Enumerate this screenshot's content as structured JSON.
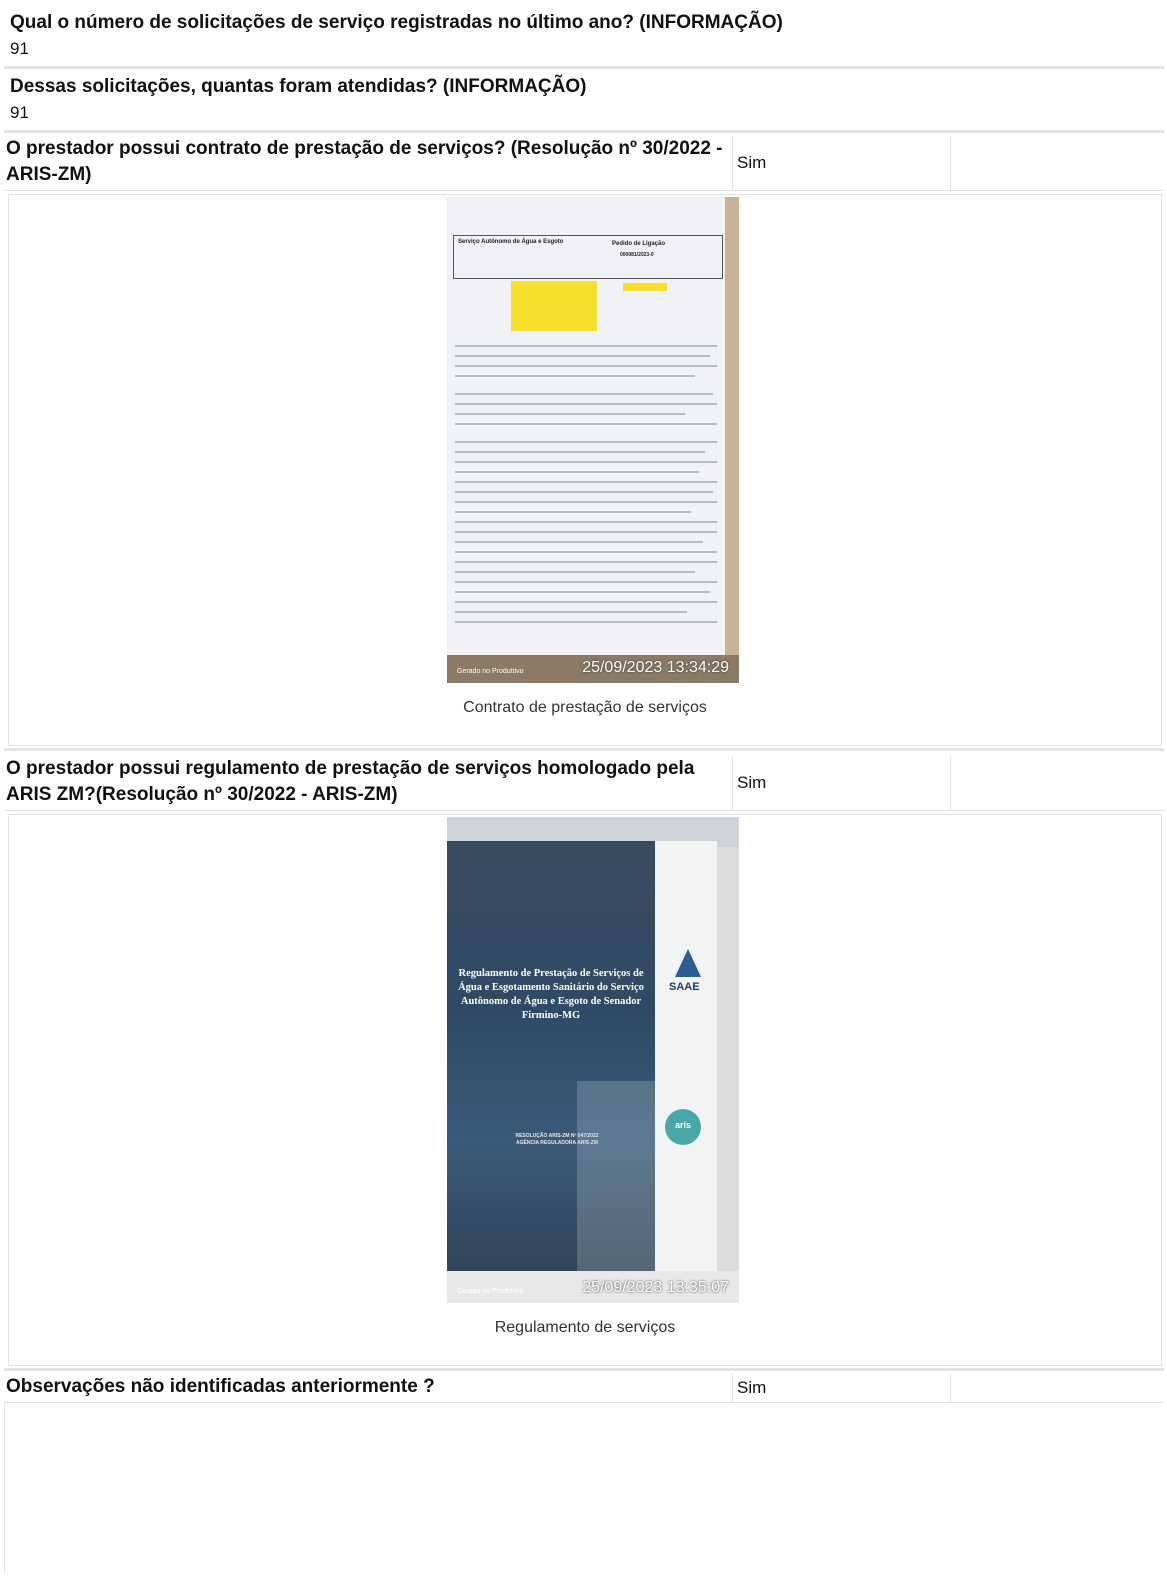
{
  "items": [
    {
      "question": "Qual o número de solicitações de serviço registradas no último ano? (INFORMAÇÃO)",
      "answer": "91"
    },
    {
      "question": "Dessas solicitações, quantas foram atendidas? (INFORMAÇÃO)",
      "answer": "91"
    },
    {
      "question": "O prestador possui contrato de prestação de serviços? (Resolução nº 30/2022 - ARIS-ZM)",
      "answer": "Sim",
      "photo": {
        "header_left": "Serviço Autônomo de Água e Esgoto",
        "header_right": "Pedido de Ligação",
        "number": "000081/2023-0",
        "footer_left": "Gerado no Produttivo",
        "timestamp": "25/09/2023 13:34:29"
      },
      "caption": "Contrato de prestação de serviços"
    },
    {
      "question": "O prestador possui regulamento de prestação de serviços homologado pela ARIS ZM?(Resolução nº 30/2022 - ARIS-ZM)",
      "answer": "Sim",
      "photo": {
        "cover_title": "Regulamento de Prestação de Serviços de Água e Esgotamento Sanitário do Serviço Autônomo de Água e Esgoto de Senador Firmino-MG",
        "resolution": "RESOLUÇÃO ARIS-ZM Nº 047/2022 AGÊNCIA REGULADORA ARIS-ZM",
        "logo_saae": "SAAE",
        "logo_aris": "aris",
        "footer_left": "Gerado no Produttivo",
        "timestamp": "25/09/2023 13:35:07"
      },
      "caption": "Regulamento de serviços"
    },
    {
      "question": "Observações não identificadas anteriormente ?",
      "answer": "Sim"
    }
  ]
}
